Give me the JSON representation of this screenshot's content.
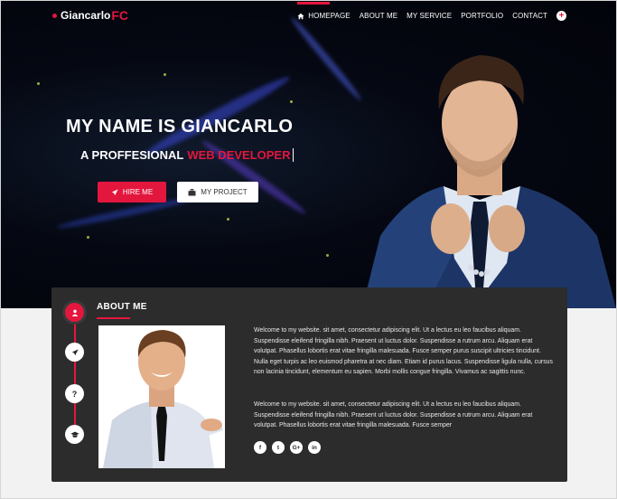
{
  "brand": {
    "name": "Giancarlo",
    "suffix": "FC"
  },
  "nav": {
    "items": [
      {
        "label": "HOMEPAGE",
        "icon": "home-icon"
      },
      {
        "label": "ABOUT ME"
      },
      {
        "label": "MY SERVICE"
      },
      {
        "label": "PORTFOLIO"
      },
      {
        "label": "CONTACT"
      }
    ],
    "extra_icon": "plus-icon"
  },
  "hero": {
    "title": "MY NAME IS GIANCARLO",
    "subtitle_prefix": "A PROFFESIONAL",
    "subtitle_accent": "WEB DEVELOPER",
    "buttons": {
      "hire": "HIRE ME",
      "project": "MY PROJECT"
    }
  },
  "about": {
    "title": "ABOUT ME",
    "paragraph1": "Welcome to my website. sit amet, consectetur adipiscing elit. Ut a lectus eu leo faucibus aliquam. Suspendisse eleifend fringilla nibh. Praesent ut luctus dolor. Suspendisse a rutrum arcu. Aliquam erat volutpat. Phasellus lobortis erat vitae fringilla malesuada. Fusce semper purus suscipit ultricies tincidunt. Nulla eget turpis ac leo euismod pharetra at nec diam. Etiam id purus lacus. Suspendisse ligula nulla, cursus non lacinia tincidunt, elementum eu sapien. Morbi mollis congue fringilla. Vivamus ac sagittis nunc.",
    "paragraph2": "Welcome to my website. sit amet, consectetur adipiscing elit. Ut a lectus eu leo faucibus aliquam. Suspendisse eleifend fringilla nibh. Praesent ut luctus dolor. Suspendisse a rutrum arcu. Aliquam erat volutpat. Phasellus lobortis erat vitae fringilla malesuada. Fusce semper",
    "timeline_icons": [
      "user-icon",
      "rocket-icon",
      "question-icon",
      "graduation-cap-icon"
    ],
    "socials": [
      {
        "icon": "facebook-icon",
        "glyph": "f"
      },
      {
        "icon": "twitter-icon",
        "glyph": "t"
      },
      {
        "icon": "google-plus-icon",
        "glyph": "G+"
      },
      {
        "icon": "linkedin-icon",
        "glyph": "in"
      }
    ]
  },
  "colors": {
    "accent": "#e3173e",
    "card": "#2c2c2c",
    "page": "#f2f2f2"
  }
}
